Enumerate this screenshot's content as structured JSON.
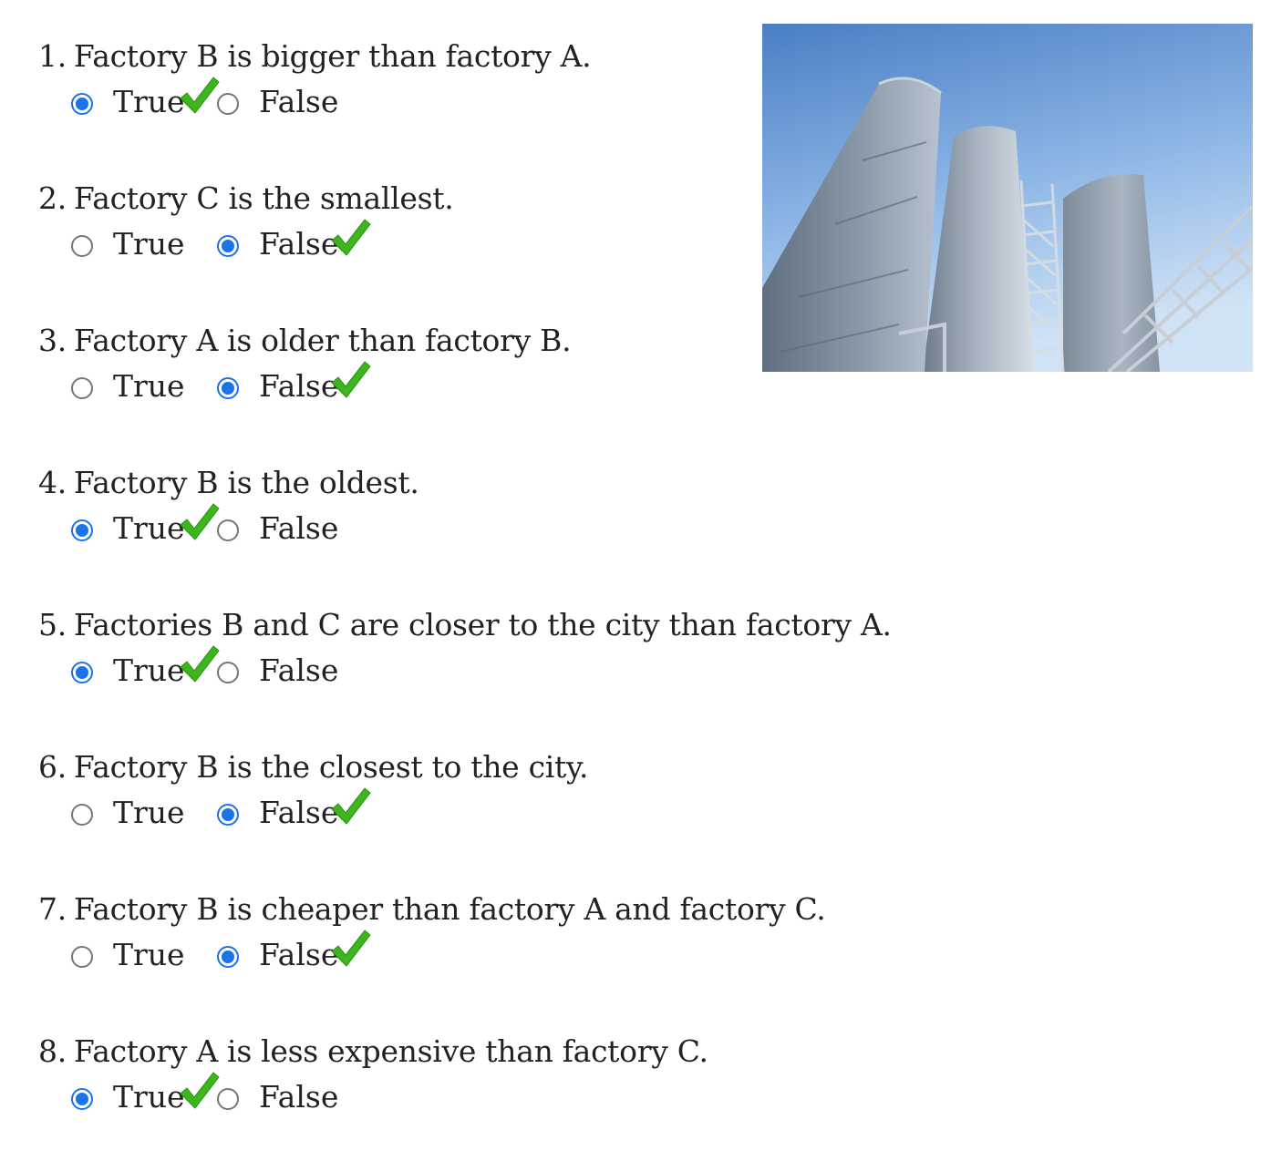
{
  "questions": [
    {
      "number": "1.",
      "text": "Factory B is bigger than factory A.",
      "true_label": "True",
      "false_label": "False",
      "selected": "true",
      "correct_shown_on": "true"
    },
    {
      "number": "2.",
      "text": "Factory C is the smallest.",
      "true_label": "True",
      "false_label": "False",
      "selected": "false",
      "correct_shown_on": "false"
    },
    {
      "number": "3.",
      "text": "Factory A is older than factory B.",
      "true_label": "True",
      "false_label": "False",
      "selected": "false",
      "correct_shown_on": "false"
    },
    {
      "number": "4.",
      "text": "Factory B is the oldest.",
      "true_label": "True",
      "false_label": "False",
      "selected": "true",
      "correct_shown_on": "true"
    },
    {
      "number": "5.",
      "text": "Factories B and C are closer to the city than factory A.",
      "true_label": "True",
      "false_label": "False",
      "selected": "true",
      "correct_shown_on": "true"
    },
    {
      "number": "6.",
      "text": "Factory B is the closest to the city.",
      "true_label": "True",
      "false_label": "False",
      "selected": "false",
      "correct_shown_on": "false"
    },
    {
      "number": "7.",
      "text": "Factory B is cheaper than factory A and factory C.",
      "true_label": "True",
      "false_label": "False",
      "selected": "false",
      "correct_shown_on": "false"
    },
    {
      "number": "8.",
      "text": "Factory A is less expensive than factory C.",
      "true_label": "True",
      "false_label": "False",
      "selected": "true",
      "correct_shown_on": "true"
    }
  ],
  "icons": {
    "correct": "check-icon",
    "photo": "factory-silos-photo"
  },
  "colors": {
    "radio_selected": "#1a73e8",
    "check_green": "#3db51d",
    "text": "#222222"
  }
}
